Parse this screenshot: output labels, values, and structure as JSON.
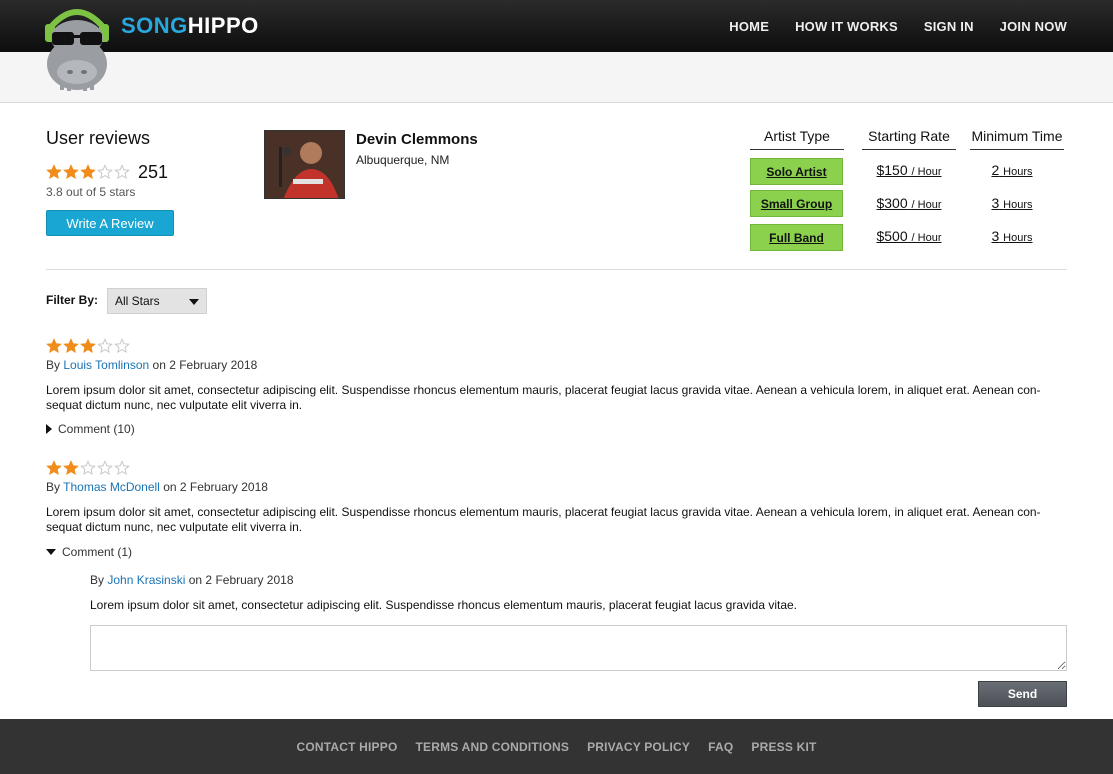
{
  "brand": {
    "part1": "SONG",
    "part2": "HIPPO"
  },
  "nav": [
    "HOME",
    "HOW IT WORKS",
    "SIGN IN",
    "JOIN NOW"
  ],
  "summary": {
    "title": "User reviews",
    "rating_stars": 3,
    "count": "251",
    "out_of": "3.8 out of 5 stars",
    "write_review": "Write A Review"
  },
  "artist": {
    "name": "Devin Clemmons",
    "location": "Albuquerque, NM"
  },
  "rates": {
    "headers": [
      "Artist Type",
      "Starting Rate",
      "Minimum Time"
    ],
    "rows": [
      {
        "type": "Solo Artist",
        "price": "$150",
        "unit": "/ Hour",
        "min": "2",
        "min_unit": "Hours"
      },
      {
        "type": "Small Group",
        "price": "$300",
        "unit": "/ Hour",
        "min": "3",
        "min_unit": "Hours"
      },
      {
        "type": "Full Band",
        "price": "$500",
        "unit": "/ Hour",
        "min": "3",
        "min_unit": "Hours"
      }
    ]
  },
  "filter": {
    "label": "Filter By:",
    "value": "All Stars"
  },
  "reviews": [
    {
      "stars": 3,
      "by": "By",
      "author": "Louis Tomlinson",
      "on": "on 2 February 2018",
      "text": "Lorem ipsum dolor sit amet, consectetur adipiscing elit. Suspendisse rhoncus elementum mauris, placerat feugiat lacus gravida vitae. Aenean a vehicula lorem, in aliquet erat. Aenean con-sequat dictum nunc, nec vulputate elit viverra in.",
      "comment": "Comment (10)"
    },
    {
      "stars": 2,
      "by": "By",
      "author": "Thomas McDonell",
      "on": "on 2 February 2018",
      "text": "Lorem ipsum dolor sit amet, consectetur adipiscing elit. Suspendisse rhoncus elementum mauris, placerat feugiat lacus gravida vitae. Aenean a vehicula lorem, in aliquet erat. Aenean con-sequat dictum nunc, nec vulputate elit viverra in.",
      "comment": "Comment (1)"
    }
  ],
  "reply": {
    "by": "By",
    "author": "John Krasinski",
    "on": "on 2 February 2018",
    "text": "Lorem ipsum dolor sit amet, consectetur adipiscing elit. Suspendisse rhoncus elementum mauris, placerat feugiat lacus gravida vitae.",
    "send": "Send"
  },
  "footer": [
    "CONTACT HIPPO",
    "TERMS AND CONDITIONS",
    "PRIVACY POLICY",
    "FAQ",
    "PRESS KIT"
  ],
  "colors": {
    "brand_blue": "#29a8de",
    "star": "#f08c1a",
    "type_green": "#8bd14e",
    "link": "#1a73b5"
  }
}
